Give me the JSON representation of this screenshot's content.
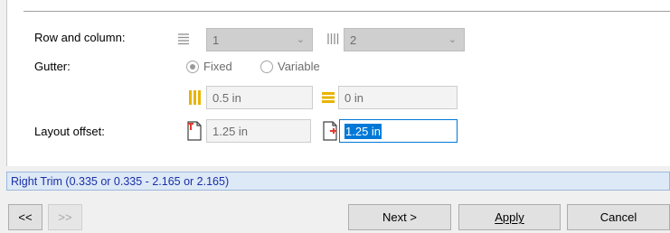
{
  "form": {
    "row_column_label": "Row and column:",
    "rows_value": "1",
    "columns_value": "2",
    "gutter_label": "Gutter:",
    "gutter_fixed_label": "Fixed",
    "gutter_variable_label": "Variable",
    "gutter_fixed_selected": true,
    "gutter_horizontal_value": "0.5 in",
    "gutter_vertical_value": "0 in",
    "layout_offset_label": "Layout offset:",
    "offset_left_value": "1.25 in",
    "offset_right_value": "1.25 in"
  },
  "status": {
    "text": "Right Trim (0.335 or 0.335 - 2.165 or 2.165)"
  },
  "buttons": {
    "prev": "<<",
    "next_page": ">>",
    "next": "Next >",
    "apply": "Apply",
    "cancel": "Cancel"
  },
  "icons": {
    "rows": "rows-lines-icon",
    "columns": "columns-lines-icon",
    "gutter_h": "horizontal-gutter-icon",
    "gutter_v": "vertical-gutter-icon",
    "offset_left": "page-offset-left-icon",
    "offset_right": "page-offset-right-icon"
  },
  "colors": {
    "accent": "#0078d7",
    "gutter_icon": "#e8b400",
    "offset_icon": "#e03a2f",
    "status_bg": "#dde9f7",
    "status_text": "#1a2fa8"
  }
}
